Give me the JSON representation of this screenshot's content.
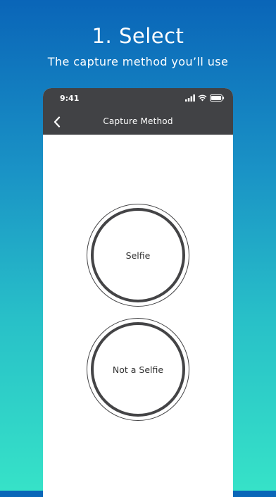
{
  "header": {
    "title": "1. Select",
    "subtitle": "The capture method you’ll use"
  },
  "status_bar": {
    "time": "9:41",
    "icons": [
      "signal-icon",
      "wifi-icon",
      "battery-icon"
    ]
  },
  "nav_bar": {
    "title": "Capture Method",
    "back_icon": "chevron-left-icon"
  },
  "options": [
    {
      "label": "Selfie"
    },
    {
      "label": "Not a Selfie"
    }
  ],
  "colors": {
    "gradient_top": "#0a65b8",
    "gradient_bottom": "#36e2c8",
    "bar": "#414245",
    "circle": "#444446"
  }
}
